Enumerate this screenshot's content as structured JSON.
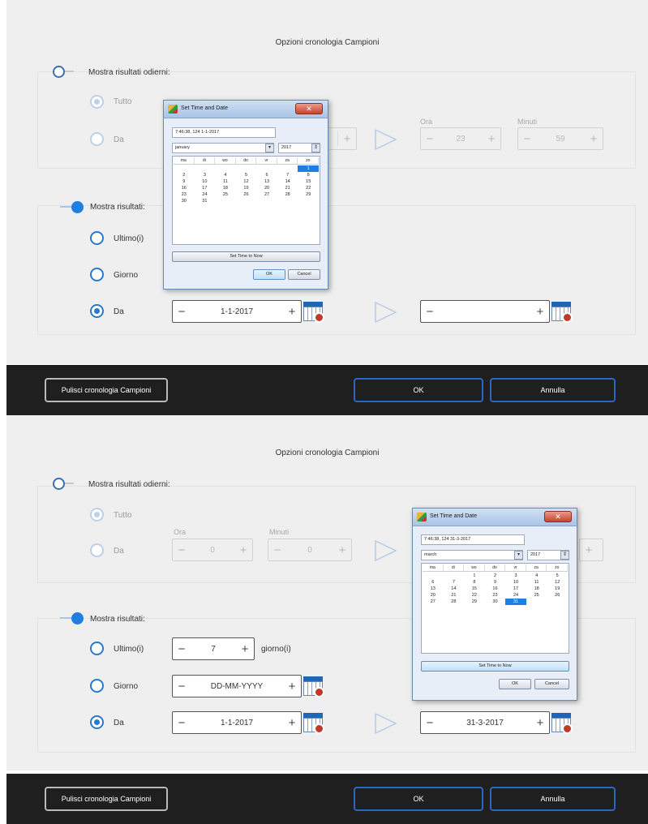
{
  "colors": {
    "accent": "#2c79c8",
    "bar": "#1f1f1f",
    "panel": "#efefef"
  },
  "icons": {
    "toggle": "toggle-switch",
    "radio": "radio-button",
    "calendar": "calendar-clock-icon",
    "arrow": "arrow-right-icon"
  },
  "panels": [
    {
      "title": "Opzioni cronologia Campioni",
      "today_group": {
        "toggle_label": "Mostra risultati odierni:",
        "all_label": "Tutto",
        "from_label": "Da",
        "hour_header": "Ora",
        "minute_header": "Minuti",
        "from_hour": "",
        "to_hour": "23",
        "to_minute": "59"
      },
      "results_group": {
        "toggle_label": "Mostra risultati:",
        "last_label": "Ultimo(i)",
        "day_label": "Giorno",
        "from_label": "Da",
        "from_date": "1-1-2017",
        "to_date": ""
      },
      "dialog": {
        "title": "Set Time and Date",
        "close": "✕",
        "datetime": "7:46:38, 124 1-1-2017",
        "month": "january",
        "year": "2017",
        "weekdays": [
          "ma",
          "di",
          "wo",
          "do",
          "vr",
          "za",
          "zo"
        ],
        "days": [
          "",
          "",
          "",
          "",
          "",
          "",
          "1",
          "2",
          "3",
          "4",
          "5",
          "6",
          "7",
          "8",
          "9",
          "10",
          "11",
          "12",
          "13",
          "14",
          "15",
          "16",
          "17",
          "18",
          "19",
          "20",
          "21",
          "22",
          "23",
          "24",
          "25",
          "26",
          "27",
          "28",
          "29",
          "30",
          "31"
        ],
        "selected_day": "1",
        "set_now": "Set Time to Now",
        "ok": "OK",
        "cancel": "Cancel"
      },
      "footer": {
        "clear": "Pulisci cronologia Campioni",
        "ok": "OK",
        "cancel": "Annulla"
      }
    },
    {
      "title": "Opzioni cronologia Campioni",
      "today_group": {
        "toggle_label": "Mostra risultati odierni:",
        "all_label": "Tutto",
        "from_label": "Da",
        "hour_header": "Ora",
        "minute_header": "Minuti",
        "from_hour": "0",
        "from_minute": "0"
      },
      "results_group": {
        "toggle_label": "Mostra risultati:",
        "last_label": "Ultimo(i)",
        "last_value": "7",
        "last_unit": "giorno(i)",
        "day_label": "Giorno",
        "day_value": "DD-MM-YYYY",
        "from_label": "Da",
        "from_date": "1-1-2017",
        "to_date": "31-3-2017"
      },
      "dialog": {
        "title": "Set Time and Date",
        "close": "✕",
        "datetime": "7:46:38, 124 31-3-2017",
        "month": "march",
        "year": "2017",
        "weekdays": [
          "ma",
          "di",
          "wo",
          "do",
          "vr",
          "za",
          "zo"
        ],
        "days": [
          "",
          "",
          "1",
          "2",
          "3",
          "4",
          "5",
          "6",
          "7",
          "8",
          "9",
          "10",
          "11",
          "12",
          "13",
          "14",
          "15",
          "16",
          "17",
          "18",
          "19",
          "20",
          "21",
          "22",
          "23",
          "24",
          "25",
          "26",
          "27",
          "28",
          "29",
          "30",
          "31"
        ],
        "selected_day": "31",
        "set_now": "Set Time to Now",
        "ok": "OK",
        "cancel": "Cancel"
      },
      "footer": {
        "clear": "Pulisci cronologia Campioni",
        "ok": "OK",
        "cancel": "Annulla"
      }
    }
  ]
}
